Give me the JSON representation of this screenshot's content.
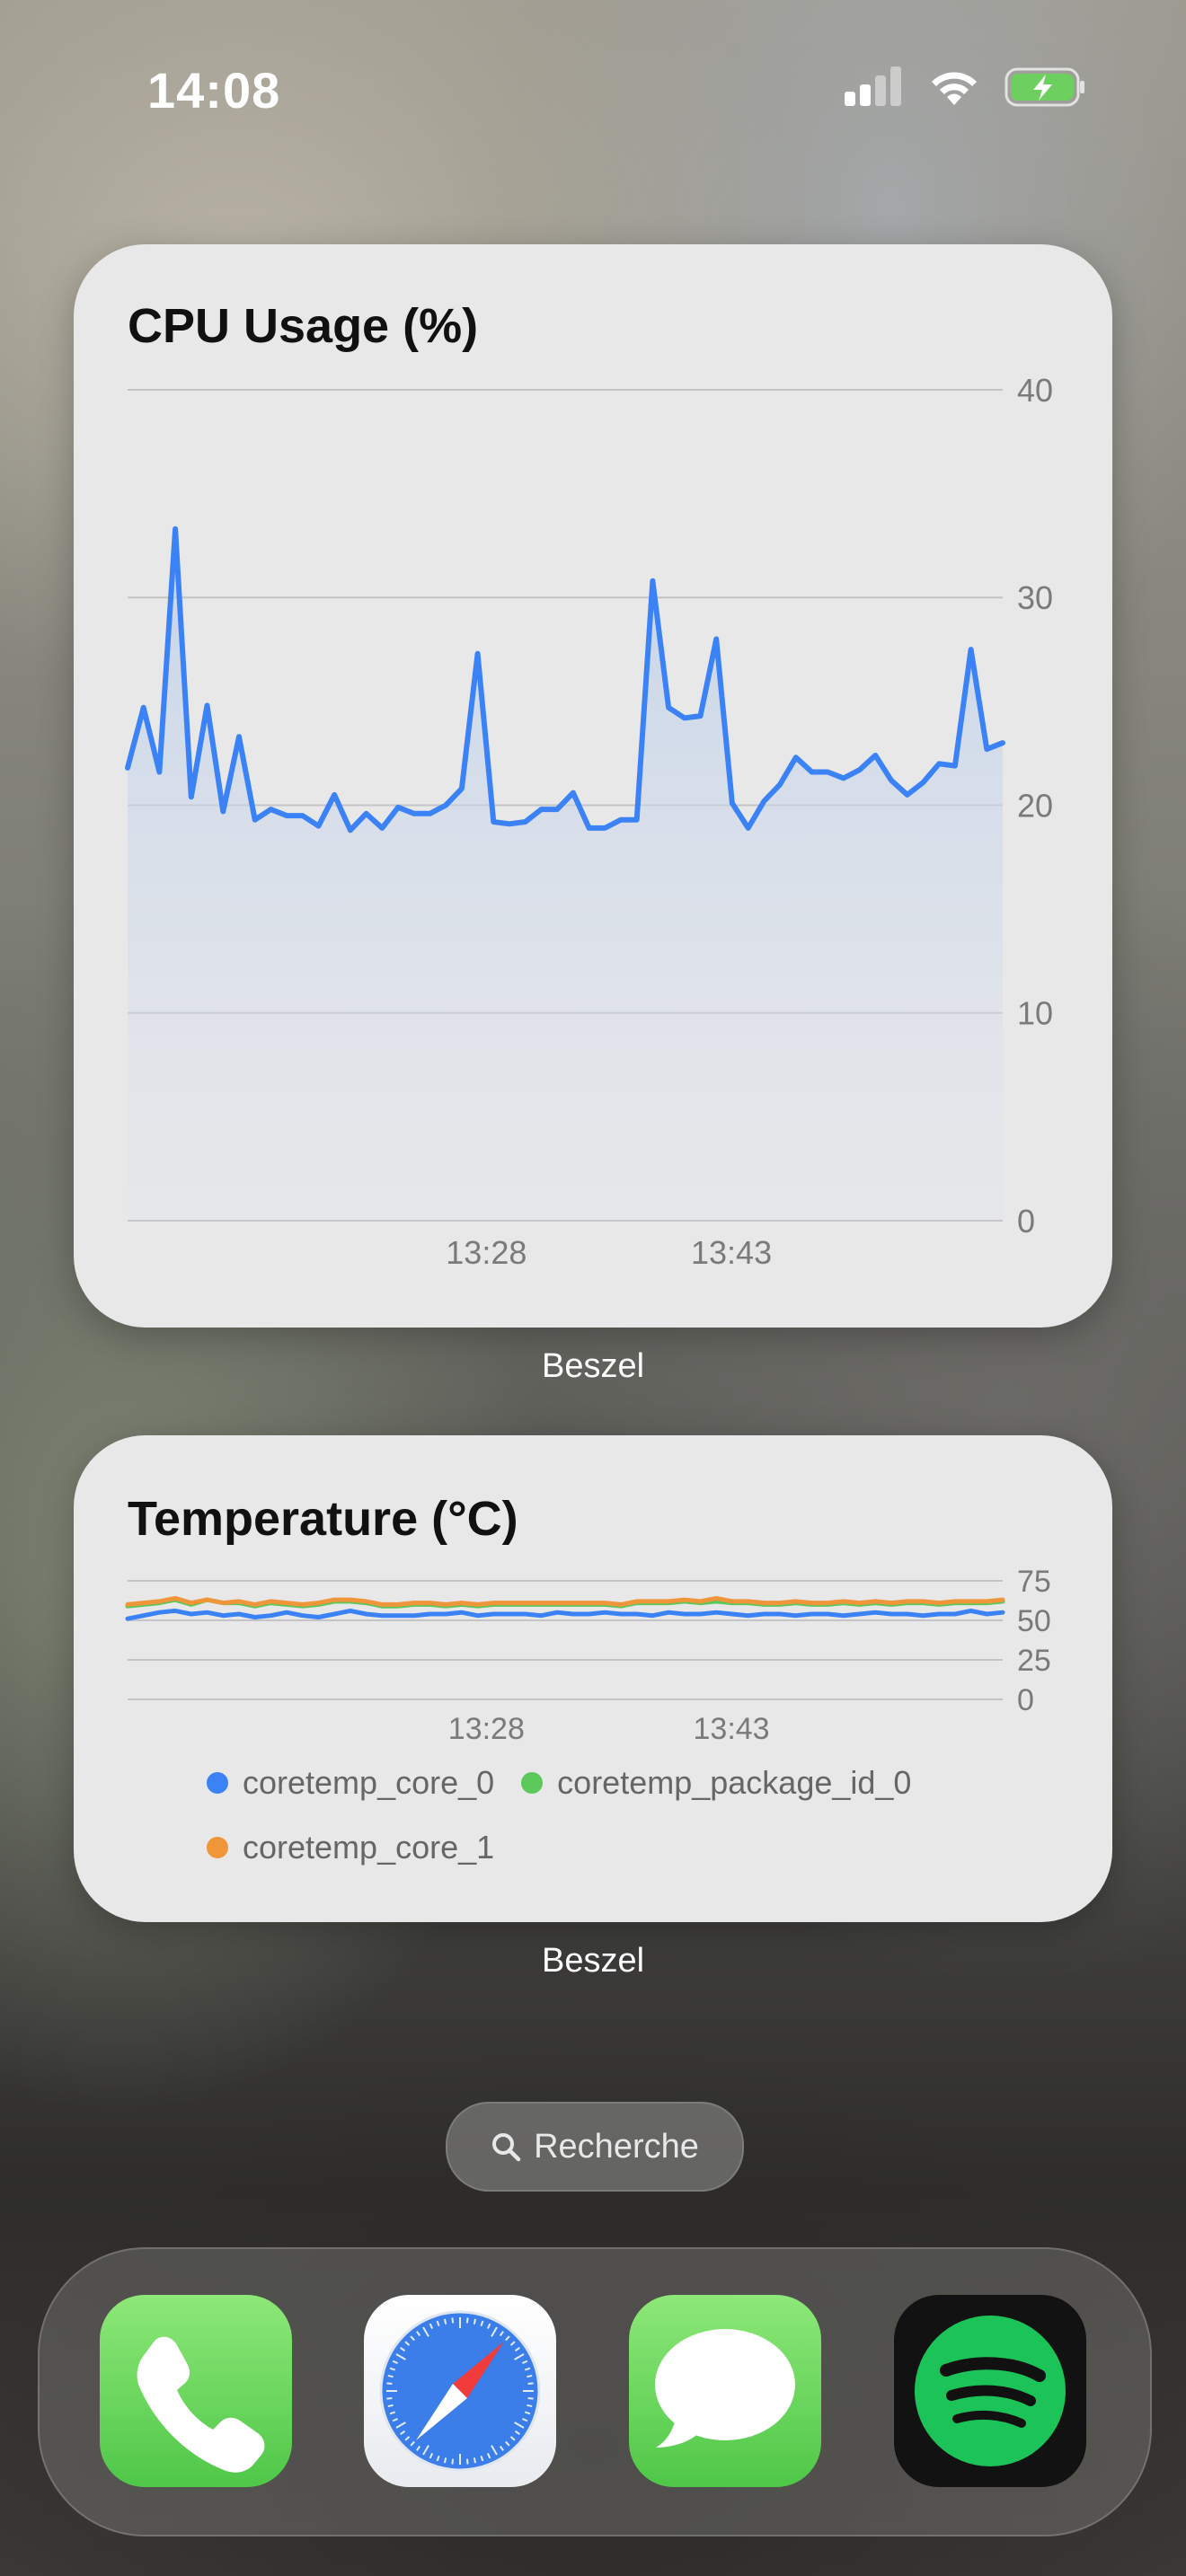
{
  "status": {
    "time": "14:08",
    "signal_icon": "cellular-signal-icon",
    "wifi_icon": "wifi-icon",
    "battery_icon": "battery-charging-icon",
    "battery_color": "#6ccf5f"
  },
  "widgets": [
    {
      "title": "CPU Usage (%)",
      "caption": "Beszel",
      "chart_data": {
        "type": "area",
        "title": "CPU Usage (%)",
        "ylim": [
          0,
          40
        ],
        "y_ticks": [
          "40",
          "30",
          "20",
          "10",
          "0"
        ],
        "x_tick_labels": [
          "13:28",
          "13:43"
        ],
        "x_tick_positions": [
          0.41,
          0.69
        ],
        "color": "#3b82f6",
        "series": [
          {
            "values": [
              21.8,
              24.7,
              21.6,
              33.3,
              20.4,
              24.8,
              19.7,
              23.3,
              19.3,
              19.8,
              19.5,
              19.5,
              19.0,
              20.5,
              18.8,
              19.6,
              18.9,
              19.9,
              19.6,
              19.6,
              20.0,
              20.8,
              27.3,
              19.2,
              19.1,
              19.2,
              19.8,
              19.8,
              20.6,
              18.9,
              18.9,
              19.3,
              19.3,
              30.8,
              24.7,
              24.2,
              24.3,
              28.0,
              20.1,
              18.9,
              20.2,
              21.0,
              22.3,
              21.6,
              21.6,
              21.3,
              21.7,
              22.4,
              21.2,
              20.5,
              21.1,
              22.0,
              21.9,
              27.5,
              22.7,
              23.0
            ]
          }
        ]
      }
    },
    {
      "title": "Temperature (°C)",
      "caption": "Beszel",
      "chart_data": {
        "type": "line",
        "title": "Temperature (°C)",
        "ylim": [
          0,
          75
        ],
        "y_ticks": [
          "75",
          "50",
          "25",
          "0"
        ],
        "x_tick_labels": [
          "13:28",
          "13:43"
        ],
        "x_tick_positions": [
          0.41,
          0.69
        ],
        "series": [
          {
            "name": "coretemp_core_0",
            "color": "#3b82f6",
            "values": [
              51,
              53,
              55,
              56,
              54,
              55,
              53,
              54,
              52,
              53,
              55,
              53,
              52,
              54,
              56,
              54,
              53,
              53,
              53,
              54,
              54,
              55,
              53,
              54,
              54,
              54,
              53,
              55,
              54,
              54,
              55,
              54,
              54,
              53,
              55,
              54,
              54,
              55,
              54,
              53,
              54,
              54,
              53,
              54,
              54,
              53,
              54,
              55,
              54,
              54,
              53,
              54,
              54,
              56,
              54,
              55
            ]
          },
          {
            "name": "coretemp_package_id_0",
            "color": "#5ac85a",
            "values": [
              59,
              60,
              61,
              63,
              60,
              63,
              61,
              61,
              59,
              61,
              60,
              59,
              60,
              62,
              62,
              61,
              59,
              59,
              60,
              60,
              59,
              60,
              59,
              60,
              60,
              60,
              60,
              60,
              60,
              60,
              60,
              59,
              61,
              61,
              61,
              62,
              61,
              62,
              61,
              61,
              60,
              60,
              61,
              60,
              60,
              61,
              60,
              61,
              60,
              61,
              61,
              60,
              61,
              61,
              61,
              62
            ]
          },
          {
            "name": "coretemp_core_1",
            "color": "#f0963a",
            "values": [
              60,
              61,
              62,
              64,
              61,
              63,
              61,
              62,
              60,
              62,
              61,
              60,
              61,
              63,
              63,
              62,
              60,
              60,
              61,
              61,
              60,
              61,
              60,
              61,
              61,
              61,
              61,
              61,
              61,
              61,
              61,
              60,
              62,
              62,
              62,
              63,
              62,
              64,
              62,
              62,
              61,
              61,
              62,
              61,
              61,
              62,
              61,
              62,
              61,
              62,
              62,
              61,
              62,
              62,
              62,
              63
            ]
          }
        ]
      }
    }
  ],
  "search": {
    "label": "Recherche",
    "icon": "search-icon"
  },
  "dock": [
    {
      "name": "Phone",
      "icon": "phone-icon"
    },
    {
      "name": "Safari",
      "icon": "safari-compass-icon"
    },
    {
      "name": "Messages",
      "icon": "messages-bubble-icon"
    },
    {
      "name": "Spotify",
      "icon": "spotify-icon"
    }
  ]
}
